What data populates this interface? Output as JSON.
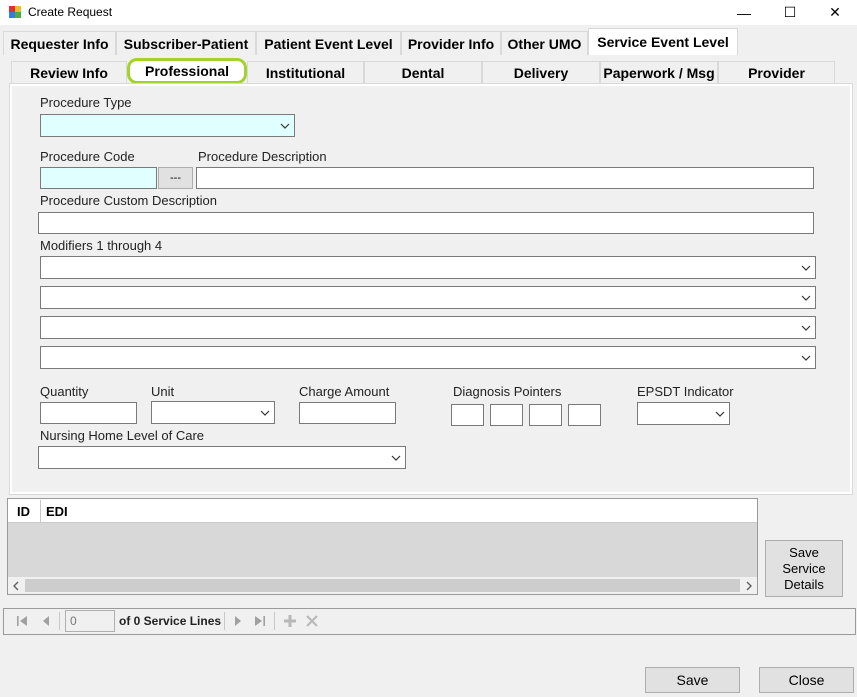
{
  "window": {
    "title": "Create Request",
    "minimize_glyph": "—",
    "maximize_glyph": "☐",
    "close_glyph": "✕"
  },
  "top_tabs": [
    "Requester Info",
    "Subscriber-Patient",
    "Patient Event Level",
    "Provider Info",
    "Other UMO",
    "Service Event Level"
  ],
  "sub_tabs": [
    "Review Info",
    "Professional",
    "Institutional",
    "Dental",
    "Delivery",
    "Paperwork / Msg",
    "Provider"
  ],
  "form": {
    "procedure_type_label": "Procedure Type",
    "procedure_code_label": "Procedure Code",
    "procedure_code_button": "---",
    "procedure_description_label": "Procedure Description",
    "procedure_custom_description_label": "Procedure Custom Description",
    "modifiers_label": "Modifiers 1 through 4",
    "quantity_label": "Quantity",
    "unit_label": "Unit",
    "charge_amount_label": "Charge Amount",
    "diagnosis_pointers_label": "Diagnosis Pointers",
    "epsdt_label": "EPSDT Indicator",
    "nursing_home_label": "Nursing Home Level of Care"
  },
  "grid": {
    "columns": [
      "ID",
      "EDI"
    ]
  },
  "save_service_details": "Save Service Details",
  "navigator": {
    "position": "0",
    "count_text": "of 0 Service Lines"
  },
  "footer": {
    "save": "Save",
    "close": "Close"
  },
  "colors": {
    "highlight": "#a4d22c",
    "required_field": "#e0ffff"
  }
}
